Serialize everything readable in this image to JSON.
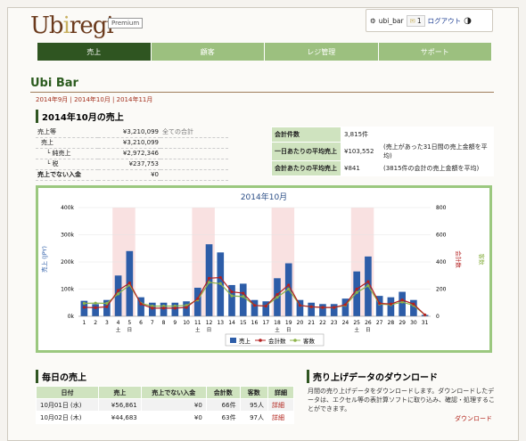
{
  "app": {
    "logo_u": "Ub",
    "logo_b": "i",
    "logo_rest": "regi",
    "plan_badge": "Premium"
  },
  "user": {
    "name": "ubi_bar",
    "mail_count": "1",
    "logout_label": "ログアウト"
  },
  "nav": {
    "tabs": [
      {
        "label": "売上"
      },
      {
        "label": "顧客"
      },
      {
        "label": "レジ管理"
      },
      {
        "label": "サポート"
      }
    ]
  },
  "page": {
    "title": "Ubi Bar",
    "month_links": [
      "2014年9月",
      "2014年10月",
      "2014年11月"
    ]
  },
  "summary": {
    "heading": "2014年10月の売上",
    "rows": [
      {
        "label": "売上等",
        "value": "¥3,210,099",
        "note": "全ての合計"
      },
      {
        "label": "売上",
        "value": "¥3,210,099",
        "note": ""
      },
      {
        "label": "└ 純売上",
        "value": "¥2,972,346",
        "note": ""
      },
      {
        "label": "└ 税",
        "value": "¥237,753",
        "note": ""
      },
      {
        "label": "売上でない入金",
        "value": "¥0",
        "note": ""
      }
    ]
  },
  "stats": {
    "rows": [
      {
        "label": "会計件数",
        "value": "3,815件",
        "note": ""
      },
      {
        "label": "一日あたりの平均売上",
        "value": "¥103,552",
        "note": "(売上があった31日間の売上金額を平均)"
      },
      {
        "label": "会計あたりの平均売上",
        "value": "¥841",
        "note": "(3815件の会計の売上金額を平均)"
      }
    ]
  },
  "chart_data": {
    "type": "bar",
    "title": "2014年10月",
    "ylabel": "売上 (JPY)",
    "y2label": "会計数",
    "y3label": "客数",
    "ylim": [
      0,
      400000
    ],
    "y2lim": [
      0,
      800
    ],
    "yticks": [
      "0k",
      "100k",
      "200k",
      "300k",
      "400k"
    ],
    "y2ticks": [
      "0",
      "200",
      "400",
      "600",
      "800"
    ],
    "categories": [
      "1",
      "2",
      "3",
      "4",
      "5",
      "6",
      "7",
      "8",
      "9",
      "10",
      "11",
      "12",
      "13",
      "14",
      "15",
      "16",
      "17",
      "18",
      "19",
      "20",
      "21",
      "22",
      "23",
      "24",
      "25",
      "26",
      "27",
      "28",
      "29",
      "30",
      "31"
    ],
    "weekend_labels": [
      {
        "day": "4",
        "text": "土"
      },
      {
        "day": "5",
        "text": "日"
      },
      {
        "day": "11",
        "text": "土"
      },
      {
        "day": "12",
        "text": "日"
      },
      {
        "day": "18",
        "text": "土"
      },
      {
        "day": "19",
        "text": "日"
      },
      {
        "day": "25",
        "text": "土"
      },
      {
        "day": "26",
        "text": "日"
      }
    ],
    "highlight_days": [
      5,
      12,
      19,
      26
    ],
    "series": [
      {
        "name": "売上",
        "type": "bar",
        "color": "#2d5da8",
        "values": [
          56861,
          44683,
          60000,
          150000,
          240000,
          70000,
          50000,
          50000,
          50000,
          55000,
          105000,
          265000,
          235000,
          115000,
          120000,
          60000,
          55000,
          140000,
          195000,
          60000,
          50000,
          45000,
          45000,
          65000,
          165000,
          220000,
          75000,
          70000,
          90000,
          60000,
          5000
        ]
      },
      {
        "name": "会計数",
        "type": "line",
        "color": "#b32020",
        "values": [
          66,
          63,
          70,
          190,
          245,
          90,
          60,
          60,
          60,
          65,
          130,
          280,
          285,
          180,
          170,
          80,
          75,
          160,
          230,
          80,
          70,
          65,
          65,
          85,
          200,
          255,
          95,
          90,
          120,
          90,
          10
        ]
      },
      {
        "name": "客数",
        "type": "line",
        "color": "#8db34a",
        "values": [
          95,
          97,
          95,
          165,
          230,
          95,
          75,
          75,
          75,
          80,
          120,
          250,
          240,
          150,
          145,
          80,
          75,
          140,
          200,
          80,
          70,
          65,
          65,
          80,
          175,
          225,
          90,
          85,
          105,
          80,
          10
        ]
      }
    ],
    "legend_position": "bottom"
  },
  "daily": {
    "heading": "毎日の売上",
    "columns": [
      "日付",
      "売上",
      "売上でない入金",
      "会計数",
      "客数",
      "詳細"
    ],
    "rows": [
      [
        "10月01日 (水)",
        "¥56,861",
        "¥0",
        "66件",
        "95人",
        "詳細"
      ],
      [
        "10月02日 (木)",
        "¥44,683",
        "¥0",
        "63件",
        "97人",
        "詳細"
      ]
    ]
  },
  "download": {
    "heading": "売り上げデータのダウンロード",
    "text": "月間の売り上げデータをダウンロードします。ダウンロードしたデータは、エクセル等の表計算ソフトに取り込み、確認・処理することができます。",
    "link": "ダウンロード"
  },
  "colors": {
    "primary": "#2f5521",
    "tab_inactive": "#9cc07f",
    "accent": "#b1221a"
  }
}
